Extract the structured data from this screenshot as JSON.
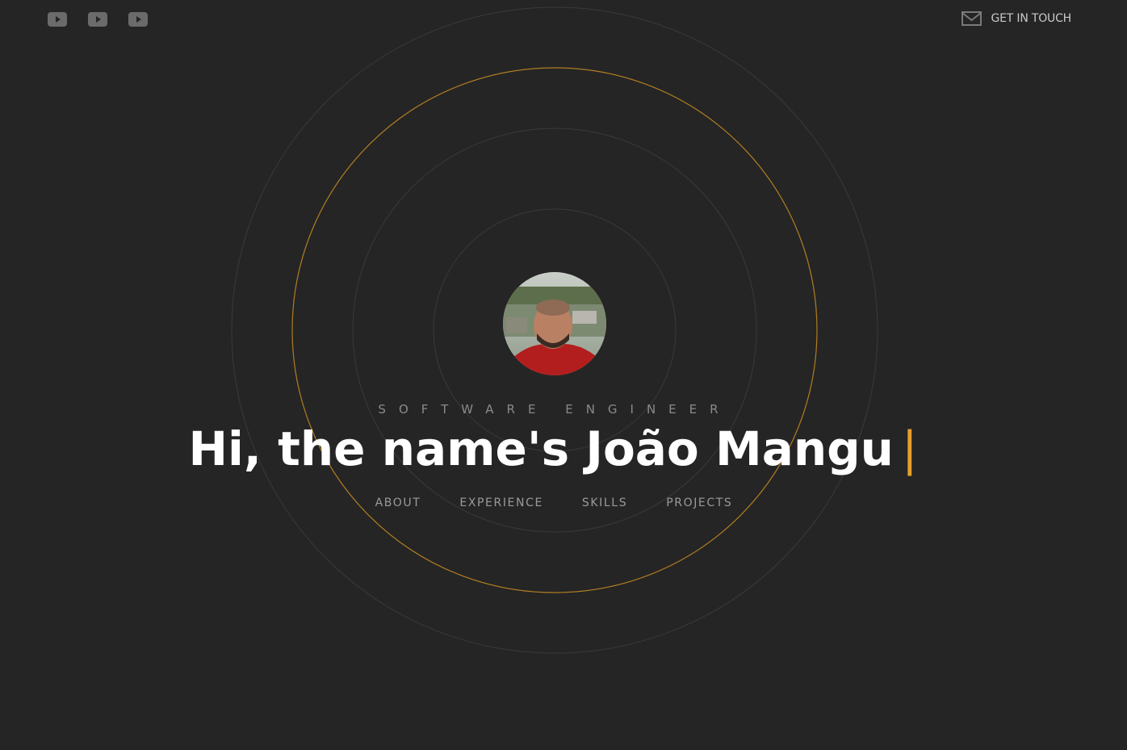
{
  "header": {
    "social_links": [
      {
        "icon": "youtube-icon"
      },
      {
        "icon": "youtube-icon"
      },
      {
        "icon": "youtube-icon"
      }
    ],
    "contact_label": "GET IN TOUCH",
    "contact_icon": "mail-icon"
  },
  "hero": {
    "role": "SOFTWARE ENGINEER",
    "headline": "Hi, the name's João Mangu",
    "cursor": "|",
    "avatar_icon": "profile-photo"
  },
  "nav": {
    "items": [
      "ABOUT",
      "EXPERIENCE",
      "SKILLS",
      "PROJECTS"
    ]
  },
  "colors": {
    "background": "#252525",
    "accent": "#e6a02a",
    "ring": "#3a3a3a",
    "text": "#ffffff",
    "muted": "#8a8a8a"
  }
}
